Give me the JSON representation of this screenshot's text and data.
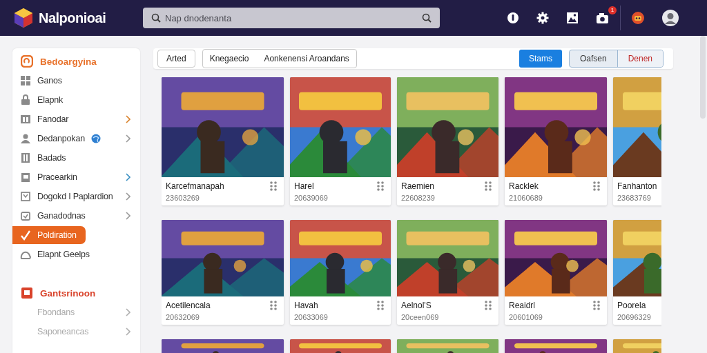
{
  "header": {
    "app_name": "Nalponioai",
    "search": {
      "placeholder": "Nap dnodenanta"
    },
    "notification_count": "1"
  },
  "sidebar": {
    "sections": [
      {
        "title": "Bedoargyina",
        "color": "#e8712a",
        "items": [
          {
            "label": "Ganos",
            "selected": false,
            "disabled": false
          },
          {
            "label": "Elapnk",
            "selected": false,
            "disabled": false
          },
          {
            "label": "Fanodar",
            "selected": false,
            "disabled": false,
            "chevron": true,
            "color": "#d9822b"
          },
          {
            "label": "Dedanpokan",
            "selected": false,
            "disabled": false,
            "chevron": true,
            "color": "#9a9a9a",
            "badge": true
          },
          {
            "label": "Badads",
            "selected": false,
            "disabled": false
          },
          {
            "label": "Pracearkin",
            "selected": false,
            "disabled": false,
            "chevron": true,
            "color": "#3a8fc2"
          },
          {
            "label": "Dogokd I Paplardion",
            "selected": false,
            "disabled": false,
            "chevron": true,
            "color": "#9a9a9a"
          },
          {
            "label": "Ganadodnas",
            "selected": false,
            "disabled": false,
            "chevron": true,
            "color": "#9a9a9a"
          },
          {
            "label": "Poldiration",
            "selected": true,
            "disabled": false
          },
          {
            "label": "Elapnt Geelps",
            "selected": false,
            "disabled": false
          }
        ]
      },
      {
        "title": "Gantsrinoon",
        "color": "#d9432b",
        "items": [
          {
            "label": "Fbondans",
            "selected": false,
            "disabled": true,
            "chevron": true,
            "color": "#b0b0b0"
          },
          {
            "label": "Saponeancas",
            "selected": false,
            "disabled": true,
            "chevron": true,
            "color": "#b0b0b0"
          }
        ]
      }
    ]
  },
  "toolbar": {
    "filter": "Arted",
    "segment": [
      "Knegaecio",
      "Aonkenensi Aroandans"
    ],
    "primary": "Stams",
    "actions": [
      {
        "label": "Oafsen",
        "kind": "plain"
      },
      {
        "label": "Denen",
        "kind": "danger"
      }
    ]
  },
  "rows": [
    {
      "cards": [
        {
          "title": "Karcefmanapah",
          "subtitle": "23603269"
        },
        {
          "title": "Harel",
          "subtitle": "20639069"
        },
        {
          "title": "Raemien",
          "subtitle": "22608239"
        },
        {
          "title": "Racklek",
          "subtitle": "21060689"
        },
        {
          "title": "Fanhanton",
          "subtitle": "23683769"
        }
      ]
    },
    {
      "cards": [
        {
          "title": "Acetilencala",
          "subtitle": "20632069"
        },
        {
          "title": "Havah",
          "subtitle": "20633069"
        },
        {
          "title": "Aelnol'S",
          "subtitle": "20ceen069"
        },
        {
          "title": "Reaidrl",
          "subtitle": "20601069"
        },
        {
          "title": "Poorela",
          "subtitle": "20696329"
        }
      ]
    },
    {
      "cards": [
        {
          "kind": "picture"
        },
        {
          "kind": "picture"
        },
        {
          "kind": "picture"
        },
        {
          "kind": "picture"
        },
        {
          "kind": "picture"
        }
      ]
    }
  ]
}
